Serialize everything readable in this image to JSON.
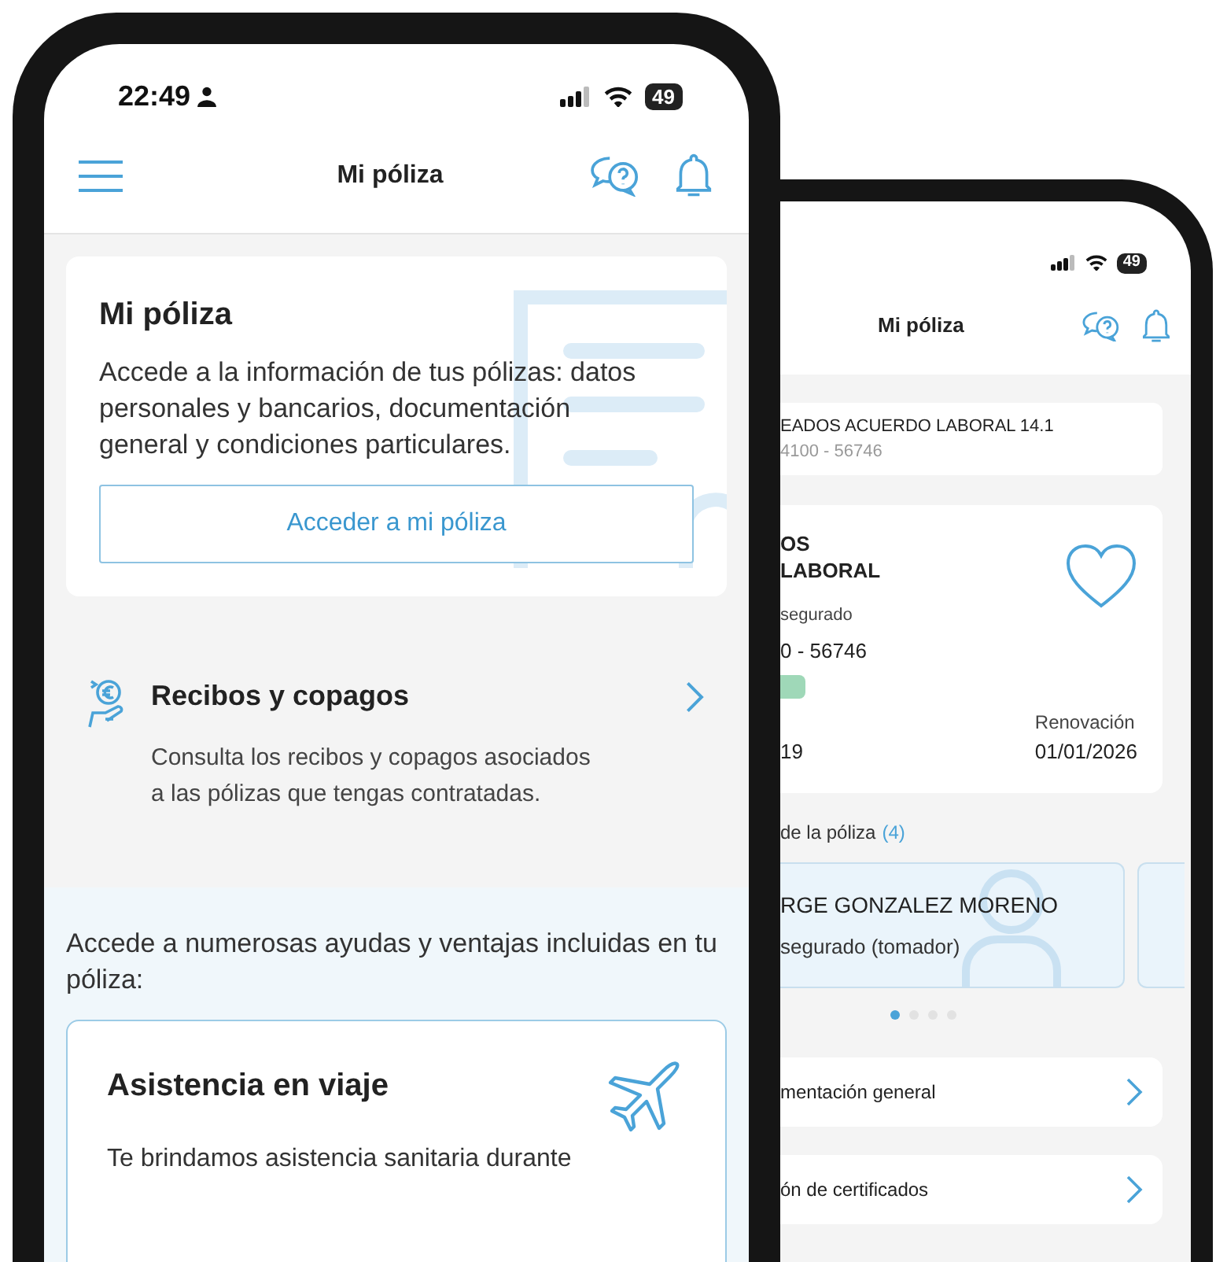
{
  "front_phone": {
    "status_bar": {
      "time": "22:49",
      "battery": "49"
    },
    "header": {
      "title": "Mi póliza"
    },
    "policy_card": {
      "title": "Mi póliza",
      "description": "Accede a la información de tus pólizas: datos personales y bancarios, documentación general y condiciones particulares.",
      "button": "Acceder a mi póliza"
    },
    "receipts": {
      "title": "Recibos y copagos",
      "description": "Consulta los recibos y copagos asociados a las pólizas que tengas contratadas."
    },
    "benefits": {
      "intro": "Accede a numerosas ayudas y ventajas incluidas en tu póliza:",
      "card": {
        "title": "Asistencia en viaje",
        "description": "Te brindamos asistencia sanitaria durante"
      }
    }
  },
  "back_phone": {
    "status_bar": {
      "battery": "49"
    },
    "header": {
      "title": "Mi póliza"
    },
    "policy_selector": {
      "name": "EADOS ACUERDO LABORAL 14.1",
      "number": "4100 - 56746"
    },
    "policy_card": {
      "name_lines": [
        "OS",
        "LABORAL"
      ],
      "insured_label": "segurado",
      "insured_number": "0 - 56746",
      "start_date": "19",
      "renewal_label": "Renovación",
      "renewal_date": "01/01/2026"
    },
    "insured": {
      "title": "de la póliza",
      "count": "(4)",
      "people": [
        {
          "name": "RGE GONZALEZ MORENO",
          "role": "segurado (tomador)"
        }
      ],
      "dots": [
        {
          "selected": true
        },
        {
          "selected": false
        },
        {
          "selected": false
        },
        {
          "selected": false
        }
      ]
    },
    "links": [
      "mentación general",
      "ón de certificados"
    ]
  }
}
